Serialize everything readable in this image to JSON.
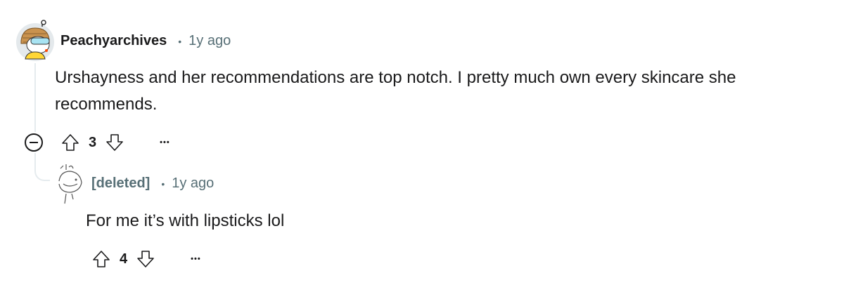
{
  "comments": [
    {
      "username": "Peachyarchives",
      "separator": "•",
      "time": "1y ago",
      "body": "Urshayness and her recommendations are top notch. I pretty much own every skincare she recommends.",
      "score": "3",
      "more_label": "•••",
      "avatar_icon": "snoo-avatar-icon"
    },
    {
      "username": "[deleted]",
      "separator": "•",
      "time": "1y ago",
      "body": "For me it’s with lipsticks lol",
      "score": "4",
      "more_label": "•••",
      "avatar_icon": "deleted-user-avatar-icon"
    }
  ],
  "colors": {
    "text": "#1a1a1b",
    "meta": "#576f76",
    "thread_line": "#e5ebee",
    "avatar_bg": "#e4e9ec",
    "avatar_accent": "#ffd635"
  }
}
